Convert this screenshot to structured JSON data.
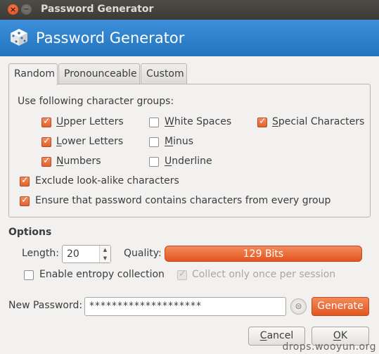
{
  "window": {
    "title": "Password Generator",
    "close_glyph": "×",
    "minimize_glyph": "−"
  },
  "banner": {
    "title": "Password Generator",
    "icon": "dice-icon"
  },
  "tabs": [
    {
      "label": "Random",
      "active": true
    },
    {
      "label": "Pronounceable",
      "active": false
    },
    {
      "label": "Custom",
      "active": false
    }
  ],
  "random": {
    "groups_label": "Use following character groups:",
    "groups": {
      "upper_letters": {
        "label": "Upper Letters",
        "checked": true
      },
      "lower_letters": {
        "label": "Lower Letters",
        "checked": true
      },
      "numbers": {
        "label": "Numbers",
        "checked": true
      },
      "white_spaces": {
        "label": "White Spaces",
        "checked": false
      },
      "minus": {
        "label": "Minus",
        "checked": false
      },
      "underline": {
        "label": "Underline",
        "checked": false
      },
      "special_characters": {
        "label": "Special Characters",
        "checked": true
      }
    },
    "exclude_lookalike": {
      "label": "Exclude look-alike characters",
      "checked": true
    },
    "ensure_every_group": {
      "label": "Ensure that password contains characters from every group",
      "checked": true
    }
  },
  "options": {
    "title": "Options",
    "length_label": "Length:",
    "length_value": "20",
    "quality_label": "Quality:",
    "quality_value": "129 Bits",
    "entropy": {
      "label": "Enable entropy collection",
      "checked": false
    },
    "collect_once": {
      "label": "Collect only once per session",
      "checked": true,
      "disabled": true
    }
  },
  "new_password": {
    "label": "New Password:",
    "value": "********************",
    "generate_label": "Generate"
  },
  "footer": {
    "cancel_label": "Cancel",
    "ok_label": "OK"
  },
  "watermark": "drops.wooyun.org",
  "colors": {
    "accent": "#e2551f",
    "banner": "#2474c0",
    "titlebar": "#3c3b37"
  }
}
